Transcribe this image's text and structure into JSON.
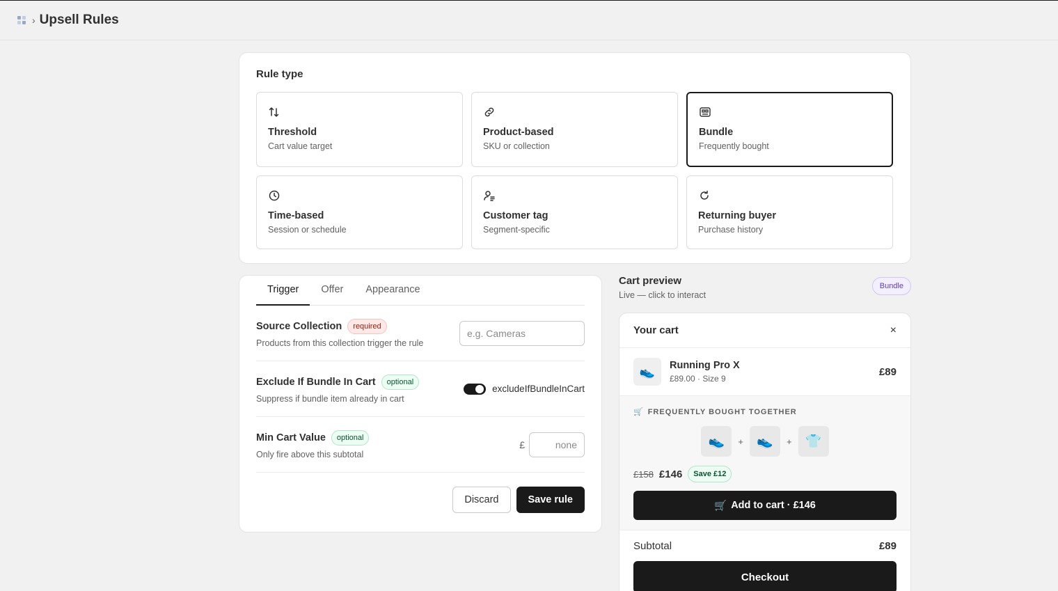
{
  "header": {
    "app_icon": "apps-grid-icon",
    "separator": "›",
    "title": "Upsell Rules"
  },
  "rule_type": {
    "title": "Rule type",
    "options": [
      {
        "name": "Threshold",
        "desc": "Cart value target",
        "icon": "arrows-swap-icon"
      },
      {
        "name": "Product-based",
        "desc": "SKU or collection",
        "icon": "link-icon"
      },
      {
        "name": "Bundle",
        "desc": "Frequently bought",
        "icon": "bundle-icon",
        "selected": true
      },
      {
        "name": "Time-based",
        "desc": "Session or schedule",
        "icon": "clock-icon"
      },
      {
        "name": "Customer tag",
        "desc": "Segment-specific",
        "icon": "customer-tag-icon"
      },
      {
        "name": "Returning buyer",
        "desc": "Purchase history",
        "icon": "refresh-icon"
      }
    ]
  },
  "tabs": [
    {
      "label": "Trigger",
      "active": true
    },
    {
      "label": "Offer"
    },
    {
      "label": "Appearance"
    }
  ],
  "fields": {
    "source": {
      "label": "Source Collection",
      "badge": "required",
      "help": "Products from this collection trigger the rule",
      "placeholder": "e.g. Cameras"
    },
    "exclude": {
      "label": "Exclude If Bundle In Cart",
      "badge": "optional",
      "help": "Suppress if bundle item already in cart",
      "toggle_label": "excludeIfBundleInCart",
      "toggle_on": true
    },
    "min_cart": {
      "label": "Min Cart Value",
      "badge": "optional",
      "help": "Only fire above this subtotal",
      "currency": "£",
      "placeholder": "none"
    }
  },
  "actions": {
    "discard": "Discard",
    "save": "Save rule"
  },
  "preview": {
    "title": "Cart preview",
    "subtitle": "Live — click to interact",
    "badge": "Bundle",
    "cart": {
      "title": "Your cart",
      "close": "×",
      "item": {
        "thumb": "👟",
        "name": "Running Pro X",
        "meta": "£89.00 · Size 9",
        "price": "£89"
      },
      "fbt": {
        "label_icon": "🛒",
        "label": "FREQUENTLY BOUGHT TOGETHER",
        "thumbs": [
          "👟",
          "👟",
          "👕"
        ],
        "plus": "+",
        "old_price": "£158",
        "new_price": "£146",
        "save": "Save £12",
        "add_icon": "🛒",
        "add_label": "Add to cart · £146"
      },
      "subtotal_label": "Subtotal",
      "subtotal_value": "£89",
      "checkout": "Checkout"
    }
  },
  "colors": {
    "primary": "#1a1a1a",
    "page_bg": "#f1f1f1",
    "required": "#8e1f0b",
    "optional": "#0c5132",
    "bundle_badge": "#5e3fb1"
  }
}
